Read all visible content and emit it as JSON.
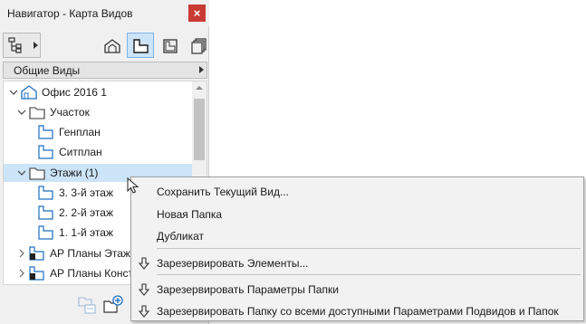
{
  "window": {
    "title": "Навигатор - Карта Видов",
    "close_label": "×"
  },
  "toolbar": {
    "buttons": [
      {
        "name": "project-map-dropdown",
        "icon": "project-map-icon"
      },
      {
        "name": "project-map",
        "icon": "house-outline-icon"
      },
      {
        "name": "view-map",
        "icon": "plan-view-icon",
        "active": true
      },
      {
        "name": "layout-book",
        "icon": "layout-book-icon"
      },
      {
        "name": "publisher-sets",
        "icon": "publisher-sets-icon"
      }
    ]
  },
  "view_set": {
    "label": "Общие Виды"
  },
  "tree": {
    "items": [
      {
        "label": "Офис 2016 1",
        "level": 0,
        "icon": "house-icon",
        "expanded": true
      },
      {
        "label": "Участок",
        "level": 1,
        "icon": "folder-icon",
        "expanded": true
      },
      {
        "label": "Генплан",
        "level": 2,
        "icon": "plan-view-icon"
      },
      {
        "label": "Ситплан",
        "level": 2,
        "icon": "plan-view-icon"
      },
      {
        "label": "Этажи (1)",
        "level": 1,
        "icon": "folder-icon",
        "expanded": true,
        "selected": true
      },
      {
        "label": "3. 3-й этаж",
        "level": 2,
        "icon": "plan-view-icon"
      },
      {
        "label": "2. 2-й этаж",
        "level": 2,
        "icon": "plan-view-icon"
      },
      {
        "label": "1. 1-й этаж",
        "level": 2,
        "icon": "plan-view-icon"
      },
      {
        "label": "АР Планы Этажей",
        "level": 0,
        "icon": "reserved-plan-icon",
        "collapsed": true
      },
      {
        "label": "АР Планы Конструкций",
        "level": 0,
        "icon": "reserved-plan-icon",
        "collapsed": true
      }
    ]
  },
  "context_menu": {
    "items": [
      {
        "label": "Сохранить Текущий Вид...",
        "icon": ""
      },
      {
        "label": "Новая Папка",
        "icon": ""
      },
      {
        "label": "Дубликат",
        "icon": ""
      },
      {
        "label": "Зарезервировать Элементы...",
        "icon": "reserve-arrow-icon"
      },
      {
        "label": "Зарезервировать Параметры Папки",
        "icon": "reserve-arrow-icon"
      },
      {
        "label": "Зарезервировать Папку со всеми доступными Параметрами Подвидов и Папок",
        "icon": "reserve-arrow-icon"
      }
    ]
  },
  "colors": {
    "selection": "#cce4f7",
    "close": "#c93a32",
    "accent": "#1f6fc0"
  }
}
